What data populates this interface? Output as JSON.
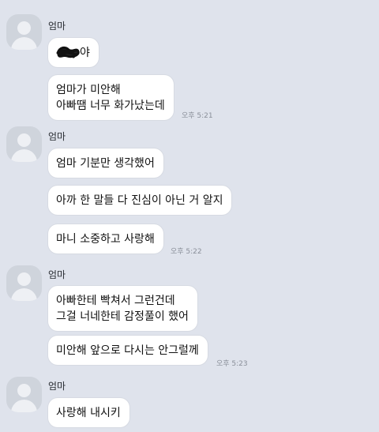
{
  "groups": [
    {
      "sender": "엄마",
      "messages": [
        {
          "text": "야",
          "redacted_prefix": true
        },
        {
          "lines": [
            "엄마가 미안해",
            "아빠땜 너무 화가났는데"
          ],
          "time": "오후 5:21"
        }
      ]
    },
    {
      "sender": "엄마",
      "messages": [
        {
          "lines": [
            "엄마 기분만 생각했어"
          ]
        },
        {
          "lines": [
            "아까 한 말들 다 진심이 아닌 거 알지"
          ]
        },
        {
          "lines": [
            "마니 소중하고 사랑해"
          ],
          "time": "오후 5:22"
        }
      ]
    },
    {
      "sender": "엄마",
      "messages": [
        {
          "lines": [
            "아빠한테 빡쳐서 그런건데",
            "그걸 너네한테 감정풀이 했어"
          ]
        },
        {
          "lines": [
            "미안해 앞으로 다시는 안그럴께"
          ],
          "time": "오후 5:23"
        }
      ]
    },
    {
      "sender": "엄마",
      "messages": [
        {
          "lines": [
            "사랑해 내시키"
          ]
        }
      ]
    }
  ],
  "colors": {
    "background": "#dfe3ec",
    "bubble": "#ffffff",
    "avatar": "#cfd4dc"
  }
}
